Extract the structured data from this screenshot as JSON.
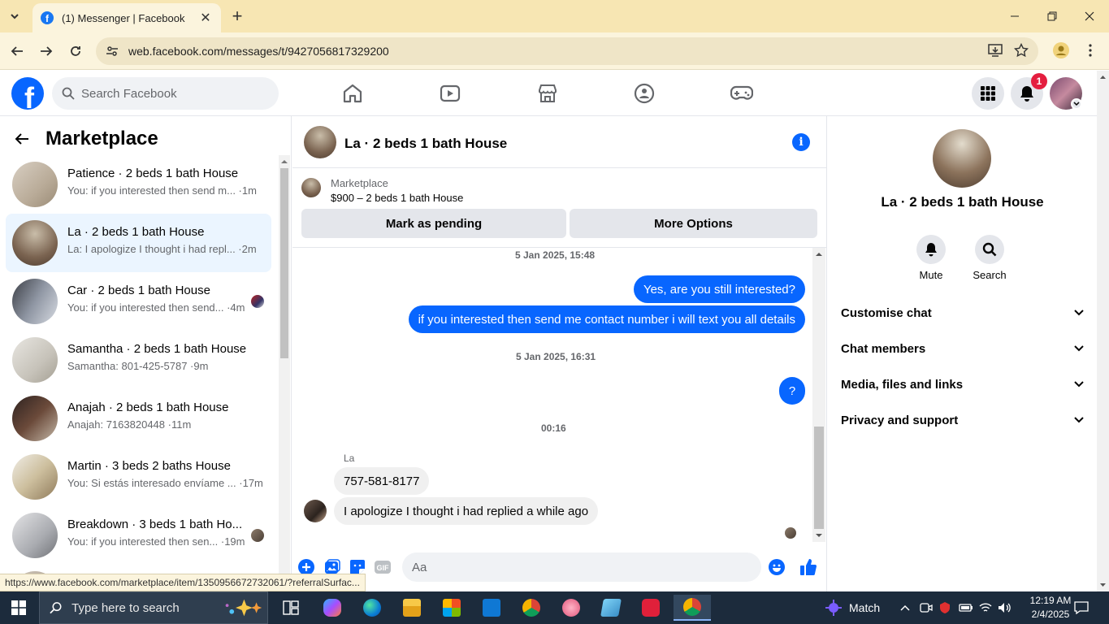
{
  "browser": {
    "tab_title": "(1) Messenger | Facebook",
    "url": "web.facebook.com/messages/t/9427056817329200",
    "status_url": "https://www.facebook.com/marketplace/item/1350956672732061/?referralSurfac..."
  },
  "fb": {
    "search_placeholder": "Search Facebook",
    "notification_count": "1"
  },
  "left": {
    "title": "Marketplace",
    "conversations": [
      {
        "name": "Patience · 2 beds 1 bath House",
        "preview": "You: if you interested then send m... ·1m"
      },
      {
        "name": "La · 2 beds 1 bath House",
        "preview": "La: I apologize I thought i had repl... ·2m"
      },
      {
        "name": "Car · 2 beds 1 bath House",
        "preview": "You: if you interested then send... ·4m"
      },
      {
        "name": "Samantha · 2 beds 1 bath House",
        "preview": "Samantha: 801-425-5787 ·9m"
      },
      {
        "name": "Anajah · 2 beds 1 bath House",
        "preview": "Anajah: 7163820448 ·11m"
      },
      {
        "name": "Martin · 3 beds 2 baths House",
        "preview": "You: Si estás interesado envíame ... ·17m"
      },
      {
        "name": "Breakdown · 3 beds 1 bath Ho...",
        "preview": "You: if you interested then sen... ·19m"
      }
    ]
  },
  "chat": {
    "title": "La · 2 beds 1 bath House",
    "marketplace_label": "Marketplace",
    "listing": "$900 – 2 beds 1 bath House",
    "btn_pending": "Mark as pending",
    "btn_more": "More Options",
    "stamp1": "5 Jan 2025, 15:48",
    "out1": "Yes, are you still interested?",
    "out2": "if you interested then send me contact number i will text you all details",
    "stamp2": "5 Jan 2025, 16:31",
    "out3": "?",
    "stamp3": "00:16",
    "sender": "La",
    "in1": "757-581-8177",
    "in2": "I apologize I thought i had replied a while ago",
    "composer_placeholder": "Aa"
  },
  "right": {
    "name": "La · 2 beds 1 bath House",
    "mute": "Mute",
    "search": "Search",
    "items": [
      "Customise chat",
      "Chat members",
      "Media, files and links",
      "Privacy and support"
    ]
  },
  "taskbar": {
    "search_placeholder": "Type here to search",
    "weather": "Match",
    "time": "12:19 AM",
    "date": "2/4/2025"
  }
}
